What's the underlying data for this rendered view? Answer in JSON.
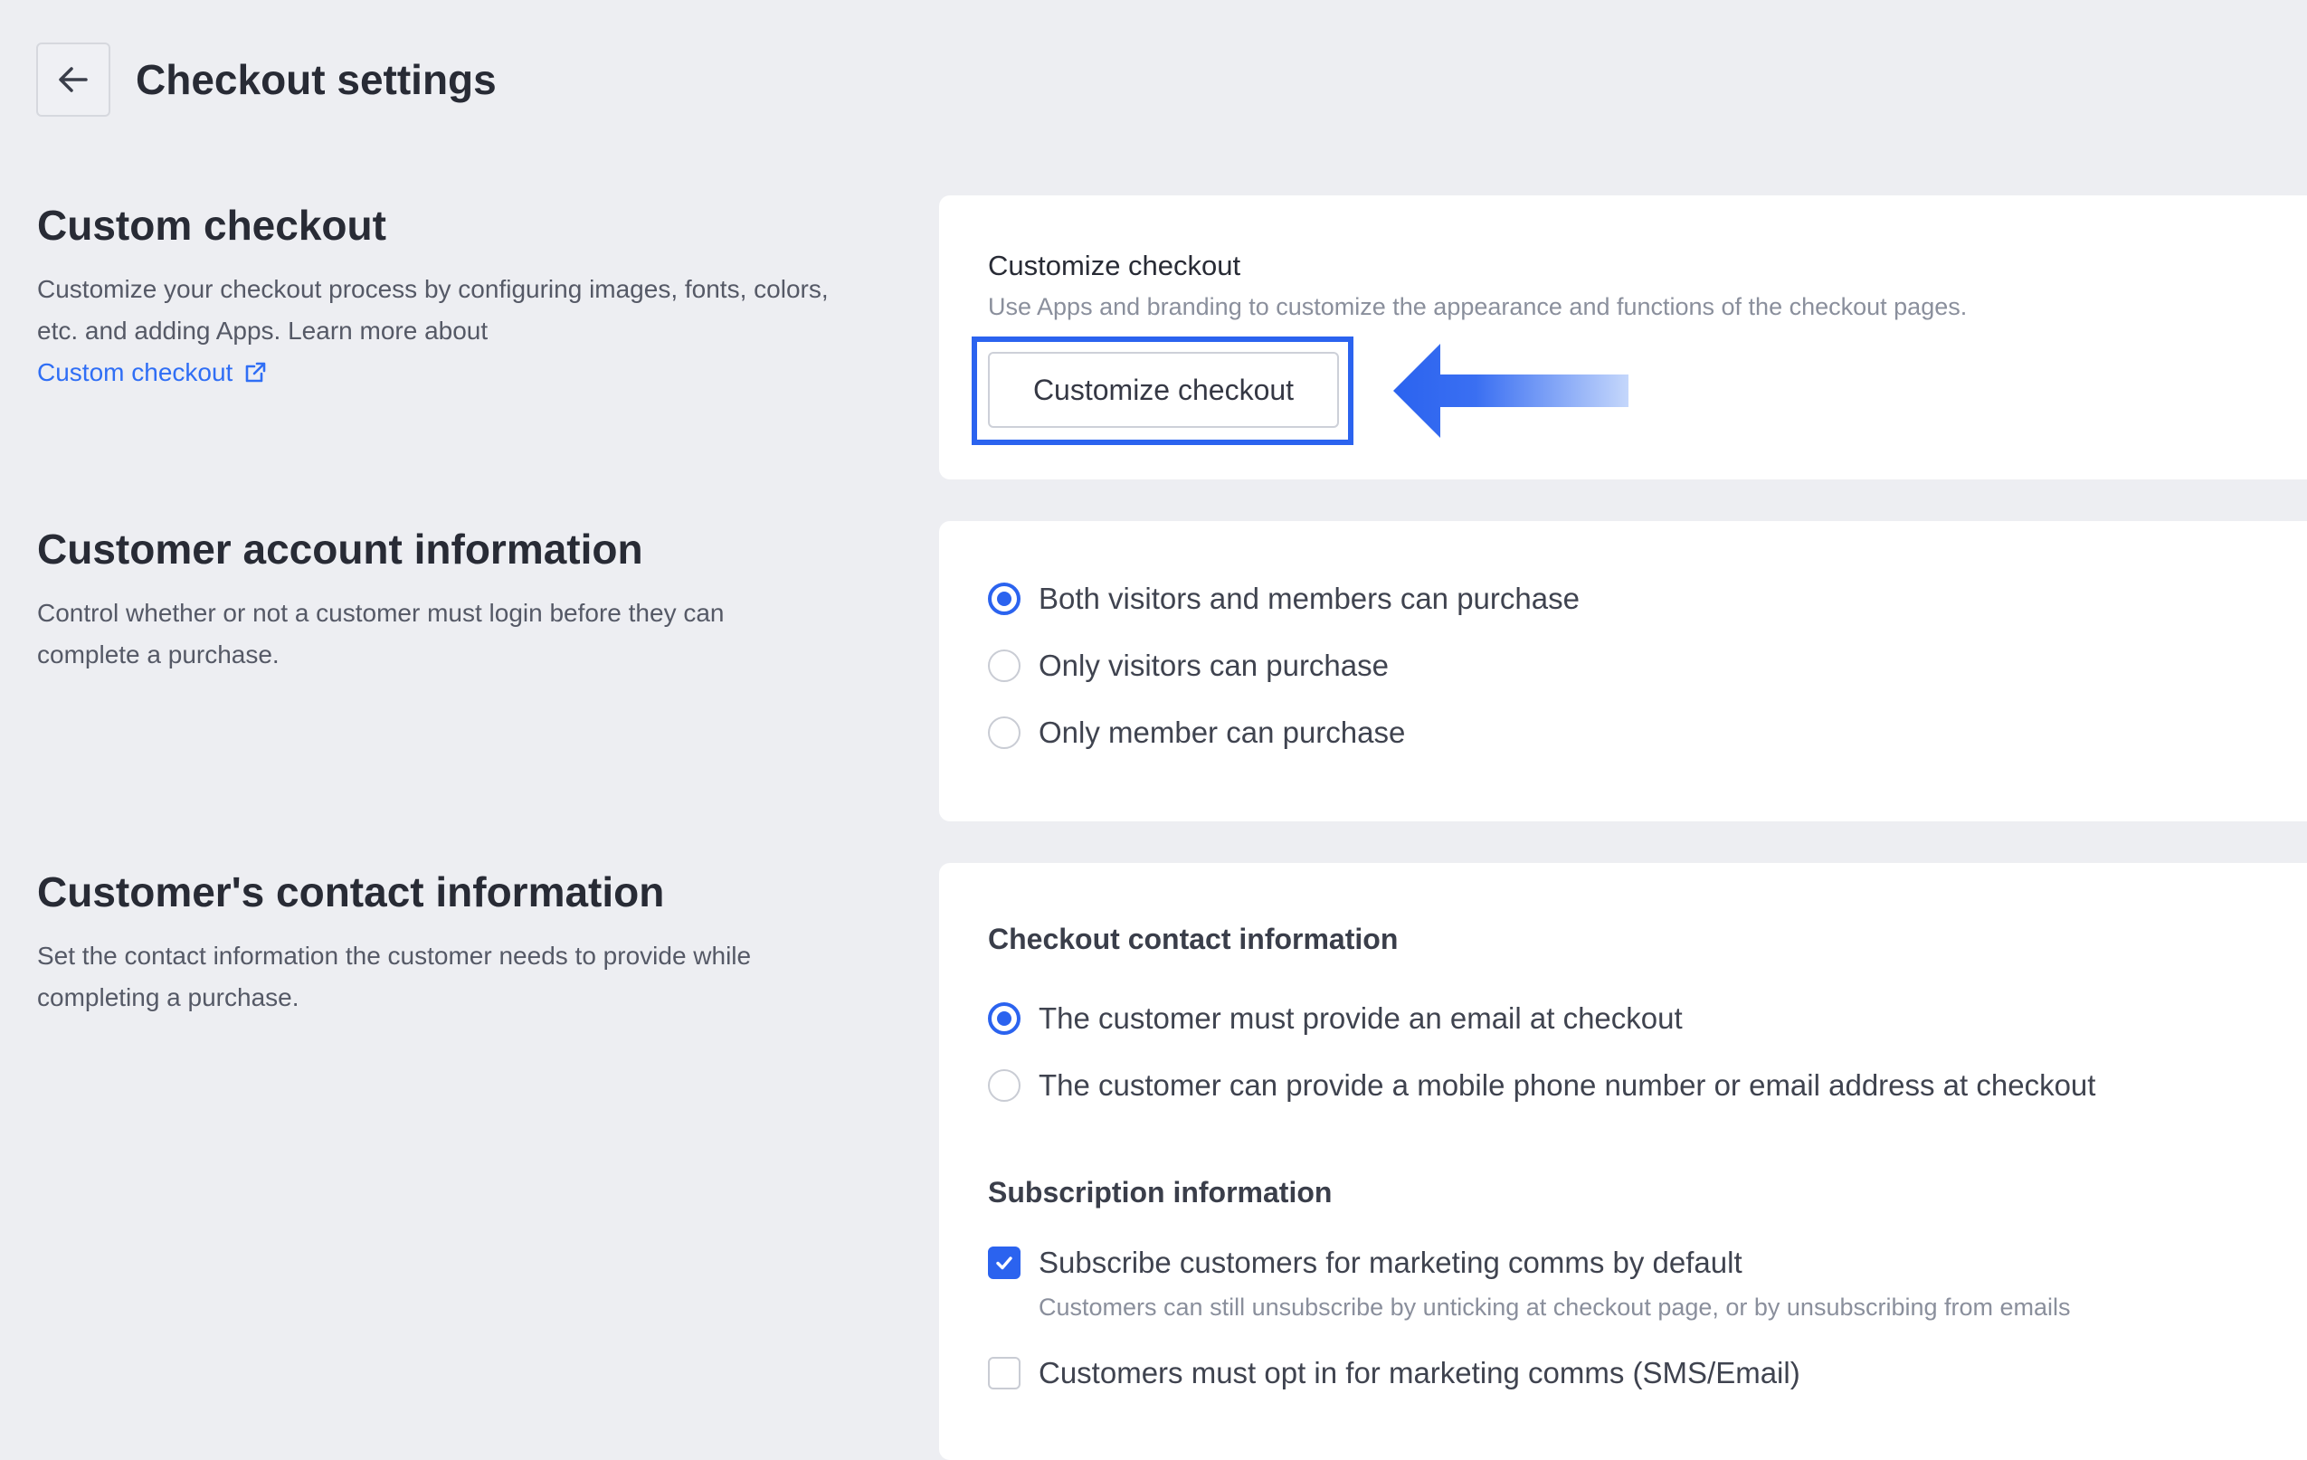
{
  "header": {
    "title": "Checkout settings",
    "back_icon": "arrow-left-icon"
  },
  "custom_checkout": {
    "title": "Custom checkout",
    "description": "Customize your checkout process by configuring images, fonts, colors, etc. and adding Apps. Learn more about",
    "link_label": "Custom checkout",
    "link_icon": "external-link-icon",
    "card_heading": "Customize checkout",
    "card_subtext": "Use Apps and branding to customize the appearance and functions of the checkout pages.",
    "button_label": "Customize checkout"
  },
  "account_info": {
    "title": "Customer account information",
    "description": "Control whether or not a customer must login before they can complete a purchase.",
    "options": [
      {
        "label": "Both visitors and members can purchase",
        "selected": true
      },
      {
        "label": "Only visitors can purchase",
        "selected": false
      },
      {
        "label": "Only member can purchase",
        "selected": false
      }
    ]
  },
  "contact_info": {
    "title": "Customer's contact information",
    "description": "Set the contact information the customer needs to provide while completing a purchase.",
    "checkout_contact_heading": "Checkout contact information",
    "contact_options": [
      {
        "label": "The customer must provide an email at checkout",
        "selected": true
      },
      {
        "label": "The customer can provide a mobile phone number or email address at checkout",
        "selected": false
      }
    ],
    "subscription_heading": "Subscription information",
    "subscription_options": [
      {
        "label": "Subscribe customers for marketing comms by default",
        "checked": true,
        "hint": "Customers can still unsubscribe by unticking at checkout page, or by unsubscribing from emails"
      },
      {
        "label": "Customers must opt in for marketing comms (SMS/Email)",
        "checked": false
      }
    ]
  },
  "colors": {
    "accent": "#2b63ef",
    "background": "#edeef2",
    "card": "#ffffff",
    "link": "#2f6ef5"
  }
}
